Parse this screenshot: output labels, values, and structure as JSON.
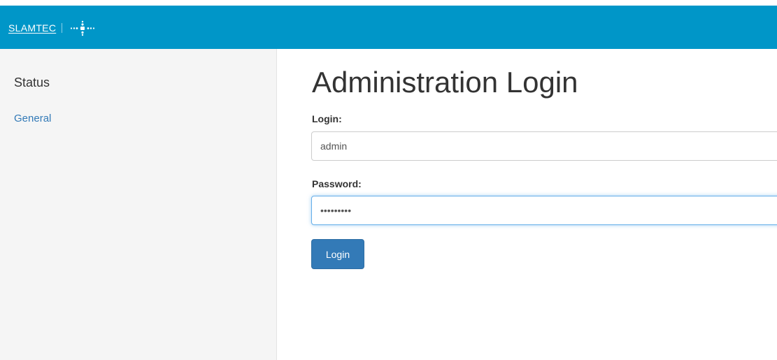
{
  "header": {
    "brand_text": "SLAMTEC",
    "logo_icon": "crosshair-dots-icon",
    "bar_color": "#0096c8"
  },
  "sidebar": {
    "heading": "Status",
    "items": [
      {
        "label": "General",
        "color": "#337ab7"
      }
    ]
  },
  "main": {
    "title": "Administration Login",
    "login_label": "Login:",
    "login_value": "admin",
    "password_label": "Password:",
    "password_value": "123456789",
    "submit_label": "Login",
    "button_color": "#337ab7"
  }
}
